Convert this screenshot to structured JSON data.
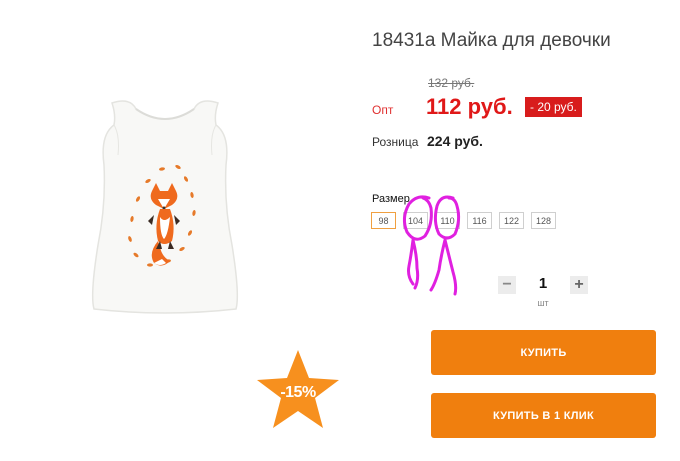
{
  "product": {
    "title": "18431а Майка для девочки",
    "discount_badge_text": "-15%"
  },
  "price": {
    "old": "132 руб.",
    "opt_label": "Опт",
    "opt_value": "112 руб.",
    "discount": "- 20 руб.",
    "retail_label": "Розница",
    "retail_value": "224 руб."
  },
  "sizes": {
    "label": "Размер",
    "options": [
      "98",
      "104",
      "110",
      "116",
      "122",
      "128"
    ],
    "selected": "98"
  },
  "quantity": {
    "minus": "−",
    "value": "1",
    "plus": "+",
    "unit": "шт"
  },
  "actions": {
    "buy": "КУПИТЬ",
    "buy_one_click": "КУПИТЬ В 1 КЛИК"
  },
  "colors": {
    "accent": "#f07f0e",
    "price_red": "#e01818",
    "annotation": "#e020e0"
  }
}
